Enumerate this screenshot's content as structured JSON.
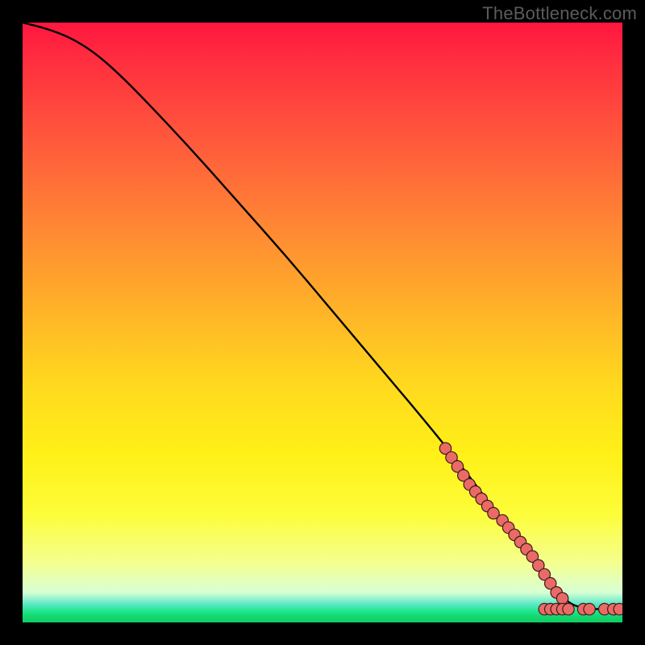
{
  "watermark": "TheBottleneck.com",
  "chart_data": {
    "type": "line",
    "title": "",
    "xlabel": "",
    "ylabel": "",
    "xlim": [
      0,
      100
    ],
    "ylim": [
      0,
      100
    ],
    "grid": false,
    "series": [
      {
        "name": "curve",
        "x": [
          0,
          4,
          8,
          12,
          16,
          20,
          28,
          36,
          44,
          52,
          60,
          68,
          74,
          80,
          84,
          88,
          90,
          93,
          100
        ],
        "y": [
          100,
          99,
          97.5,
          95,
          91.5,
          87.5,
          79,
          70,
          61,
          51.5,
          42,
          32.5,
          25,
          17,
          12,
          6.5,
          4,
          2.2,
          2.2
        ]
      }
    ],
    "points": [
      {
        "name": "cluster-upper",
        "x": [
          70.5,
          71.5,
          72.5,
          73.5,
          74.5,
          75.5,
          76.5,
          77.5,
          78.5
        ],
        "y": [
          29,
          27.5,
          26,
          24.5,
          23,
          21.8,
          20.6,
          19.4,
          18.2
        ]
      },
      {
        "name": "cluster-mid",
        "x": [
          80,
          81,
          82,
          83,
          84,
          85,
          86,
          87,
          88,
          89,
          90
        ],
        "y": [
          17,
          15.8,
          14.6,
          13.4,
          12.2,
          11,
          9.5,
          8,
          6.5,
          5,
          4
        ]
      },
      {
        "name": "flat-1",
        "x": [
          87,
          88,
          89,
          90,
          91
        ],
        "y": [
          2.2,
          2.2,
          2.2,
          2.2,
          2.2
        ]
      },
      {
        "name": "flat-2",
        "x": [
          93.5,
          94.5
        ],
        "y": [
          2.2,
          2.2
        ]
      },
      {
        "name": "flat-3",
        "x": [
          97,
          98.5,
          99.5
        ],
        "y": [
          2.2,
          2.2,
          2.2
        ]
      }
    ],
    "colors": {
      "dot_fill": "#eb6a66",
      "dot_stroke": "#3a1c1c",
      "curve": "#000000"
    }
  }
}
